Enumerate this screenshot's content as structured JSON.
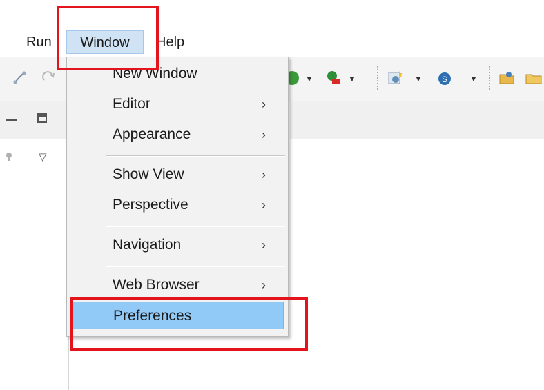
{
  "menubar": {
    "items": [
      {
        "label": "Run"
      },
      {
        "label": "Window"
      },
      {
        "label": "Help"
      }
    ]
  },
  "toolbar": {
    "icons": [
      "link-icon",
      "redo-icon",
      "run-icon",
      "run-external-tool-icon",
      "new-class-icon",
      "new-server-icon",
      "open-folder-icon",
      "folder-icon"
    ]
  },
  "dropdown": {
    "items": [
      {
        "label": "New Window",
        "submenu": false
      },
      {
        "label": "Editor",
        "submenu": true
      },
      {
        "label": "Appearance",
        "submenu": true
      },
      {
        "label": "Show View",
        "submenu": true
      },
      {
        "label": "Perspective",
        "submenu": true
      },
      {
        "label": "Navigation",
        "submenu": true
      },
      {
        "label": "Web Browser",
        "submenu": true
      },
      {
        "label": "Preferences",
        "submenu": false
      }
    ],
    "chevron": "›",
    "highlighted": "Preferences"
  },
  "view": {
    "menu_glyph": "▽"
  },
  "colors": {
    "highlight": "#91c9f7",
    "annotation": "#e3141b",
    "menu_background": "#f2f2f2"
  }
}
